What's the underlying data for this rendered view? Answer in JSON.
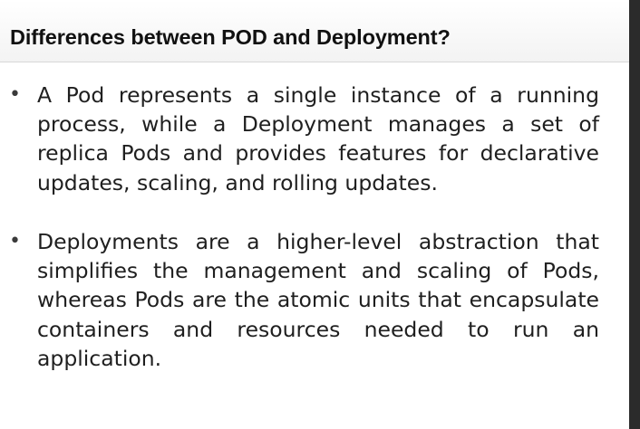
{
  "slide": {
    "title": "Differences between POD and Deployment?",
    "bullets": [
      {
        "marker": "•",
        "text": "A Pod represents a single instance of a running process, while a Deployment manages a set of replica Pods and provides features for declarative updates, scaling, and rolling updates."
      },
      {
        "marker": "•",
        "text": "Deployments are a higher-level abstraction that simplifies the management and scaling of Pods, whereas Pods are the atomic units that encapsulate containers and resources needed to run an application."
      }
    ]
  },
  "colors": {
    "background": "#ffffff",
    "text": "#1f1f1f",
    "title": "#111111",
    "edge": "#2b2b2b"
  }
}
